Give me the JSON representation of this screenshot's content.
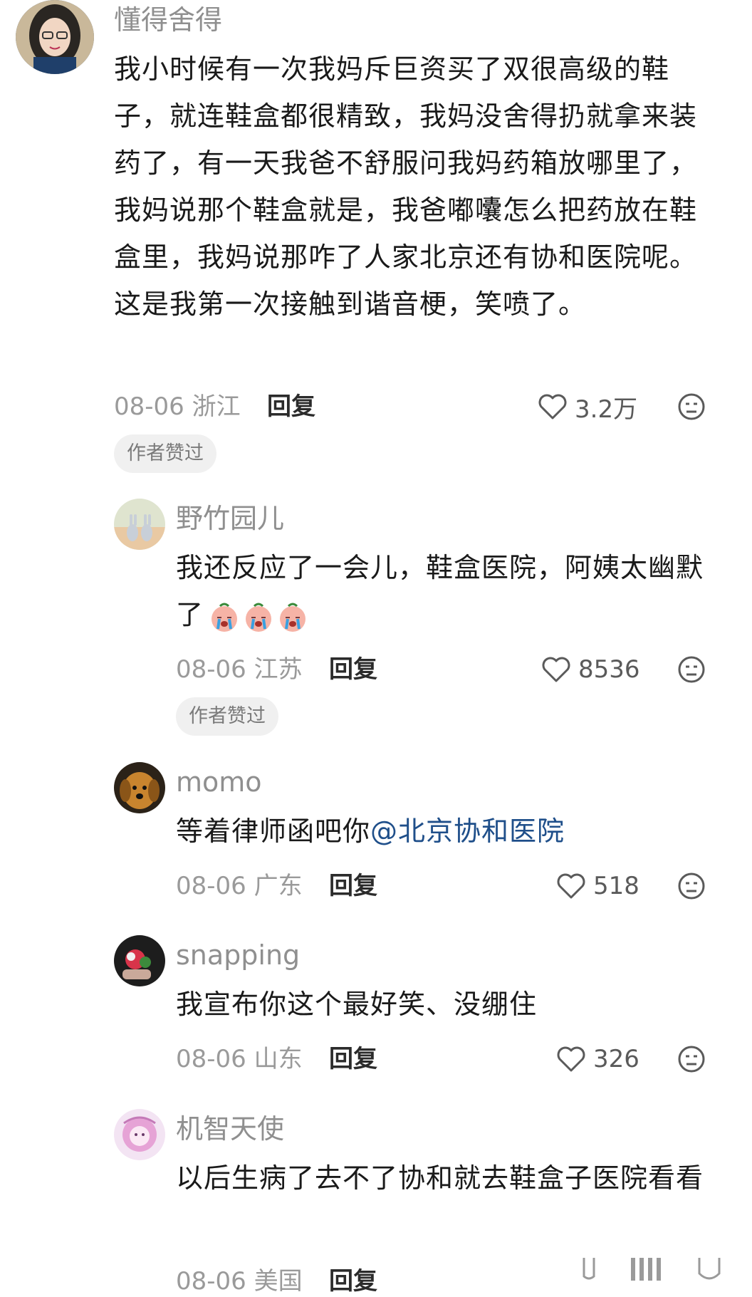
{
  "comments": [
    {
      "username": "懂得舍得",
      "text": "我小时候有一次我妈斥巨资买了双很高级的鞋子，就连鞋盒都很精致，我妈没舍得扔就拿来装药了，有一天我爸不舒服问我妈药箱放哪里了，我妈说那个鞋盒就是，我爸嘟囔怎么把药放在鞋盒里，我妈说那咋了人家北京还有协和医院呢。这是我第一次接触到谐音梗，笑喷了。",
      "date": "08-06",
      "location": "浙江",
      "reply_label": "回复",
      "likes": "3.2万",
      "badge": "作者赞过"
    },
    {
      "username": "野竹园儿",
      "text": "我还反应了一会儿，鞋盒医院，阿姨太幽默了",
      "emoji": [
        "crying-face-emoji",
        "crying-face-emoji",
        "crying-face-emoji"
      ],
      "date": "08-06",
      "location": "江苏",
      "reply_label": "回复",
      "likes": "8536",
      "badge": "作者赞过"
    },
    {
      "username": "momo",
      "text": "等着律师函吧你",
      "mention": "@北京协和医院",
      "date": "08-06",
      "location": "广东",
      "reply_label": "回复",
      "likes": "518"
    },
    {
      "username": "snapping",
      "text": "我宣布你这个最好笑、没绷住",
      "date": "08-06",
      "location": "山东",
      "reply_label": "回复",
      "likes": "326"
    },
    {
      "username": "机智天使",
      "text": "以后生病了去不了协和就去鞋盒子医院看看",
      "date": "08-06",
      "location": "美国",
      "reply_label": "回复"
    }
  ],
  "colors": {
    "username": "#8f8f8f",
    "mention": "#1f4f8a",
    "badge_bg": "#f0f0f0"
  },
  "icons": [
    "heart-outline-icon",
    "neutral-face-icon"
  ]
}
